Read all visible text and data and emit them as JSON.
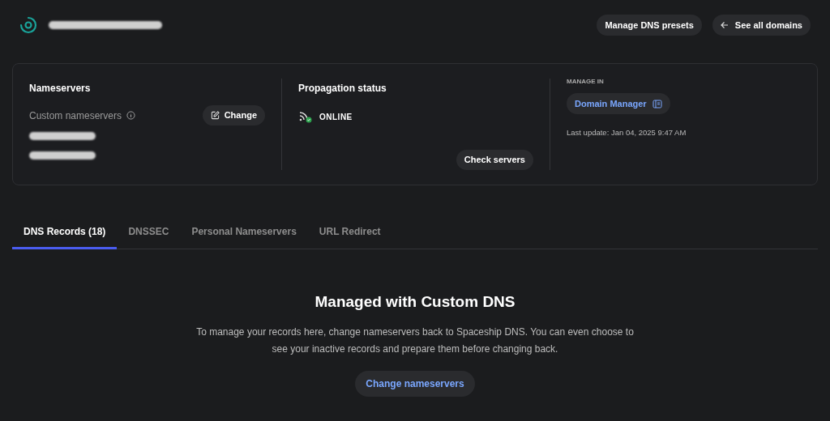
{
  "header": {
    "buttons": [
      {
        "kind": "plain",
        "label": "Manage DNS presets"
      },
      {
        "kind": "back",
        "label": "See all domains"
      }
    ]
  },
  "nameservers": {
    "title": "Nameservers",
    "subtitle": "Custom nameservers",
    "change_button": "Change"
  },
  "propagation": {
    "title": "Propagation status",
    "status": "ONLINE",
    "check_button": "Check servers"
  },
  "manage": {
    "caption": "MANAGE IN",
    "link": "Domain Manager",
    "last_update": "Last update: Jan 04, 2025 9:47 AM"
  },
  "tabs": [
    {
      "label": "DNS Records (18)",
      "selected": true
    },
    {
      "label": "DNSSEC",
      "selected": false
    },
    {
      "label": "Personal Nameservers",
      "selected": false
    },
    {
      "label": "URL Redirect",
      "selected": false
    }
  ],
  "empty_state": {
    "title": "Managed with Custom DNS",
    "text": "To manage your records here, change nameservers back to Spaceship DNS. You can even choose to see your inactive records and prepare them before changing back.",
    "button": "Change nameservers"
  }
}
